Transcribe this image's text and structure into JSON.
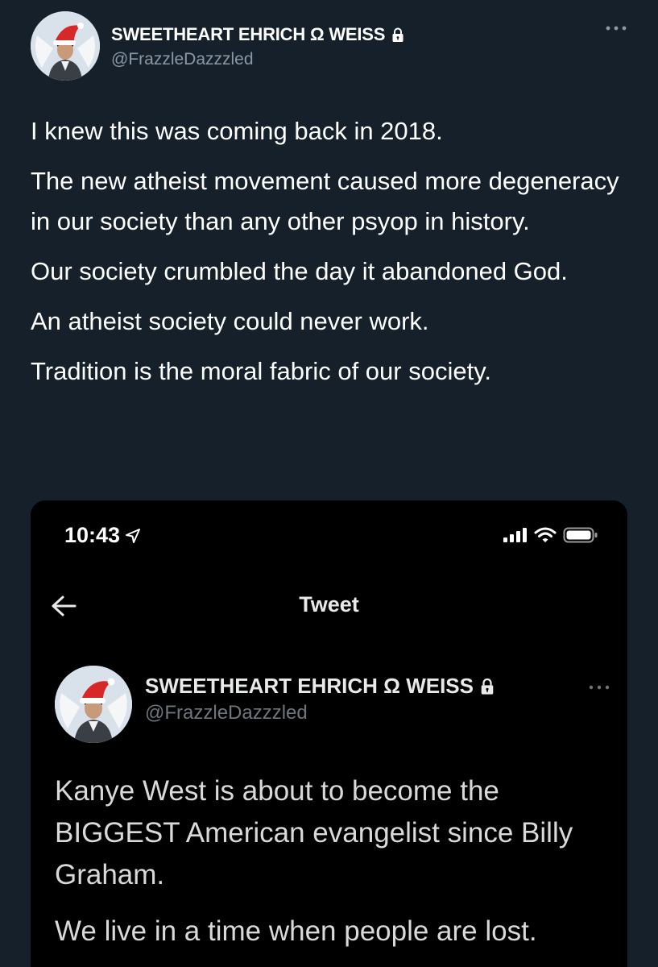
{
  "tweet": {
    "author": {
      "display_name": "SWEETHEART EHRICH Ω WEISS",
      "handle": "@FrazzleDazzzled",
      "avatar_icon": "avatar-santa-hat-wings",
      "lock_icon": "lock-icon"
    },
    "more_icon": "more-options-icon",
    "paragraphs": [
      "I knew this was coming back in 2018.",
      "The new atheist movement caused more degeneracy in our society than any other psyop in history.",
      "Our society crumbled the day it abandoned God.",
      "An atheist society could never work.",
      "Tradition is the moral fabric of our society."
    ]
  },
  "embedded_screenshot": {
    "status_bar": {
      "time": "10:43",
      "location_icon": "location-arrow-icon",
      "signal_icon": "cellular-signal-icon",
      "wifi_icon": "wifi-icon",
      "battery_icon": "battery-icon"
    },
    "nav": {
      "back_icon": "back-arrow-icon",
      "title": "Tweet"
    },
    "tweet": {
      "display_name": "SWEETHEART EHRICH Ω WEISS",
      "handle": "@FrazzleDazzzled",
      "paragraphs": [
        "Kanye West is about to become the BIGGEST American evangelist since Billy Graham.",
        "We live in a time when people are lost."
      ]
    }
  },
  "colors": {
    "background": "#15202b",
    "text_primary": "#ffffff",
    "text_secondary": "#8b98a5",
    "embedded_background": "#000000"
  }
}
